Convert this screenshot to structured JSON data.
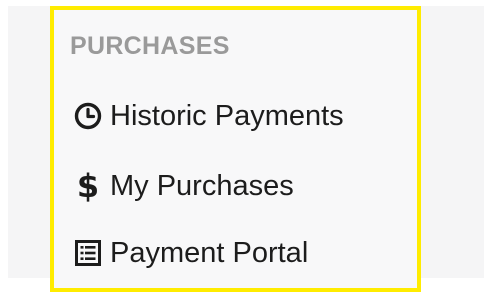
{
  "sidebar": {
    "section_title": "PURCHASES",
    "items": [
      {
        "label": "Historic Payments",
        "icon": "clock-icon"
      },
      {
        "label": "My Purchases",
        "icon": "dollar-icon",
        "glyph": "$"
      },
      {
        "label": "Payment Portal",
        "icon": "list-document-icon"
      }
    ]
  },
  "colors": {
    "highlight_border": "#ffec00",
    "heading": "#9a9a9a",
    "text": "#1c1c1c",
    "panel_background": "#f8f8f9"
  }
}
